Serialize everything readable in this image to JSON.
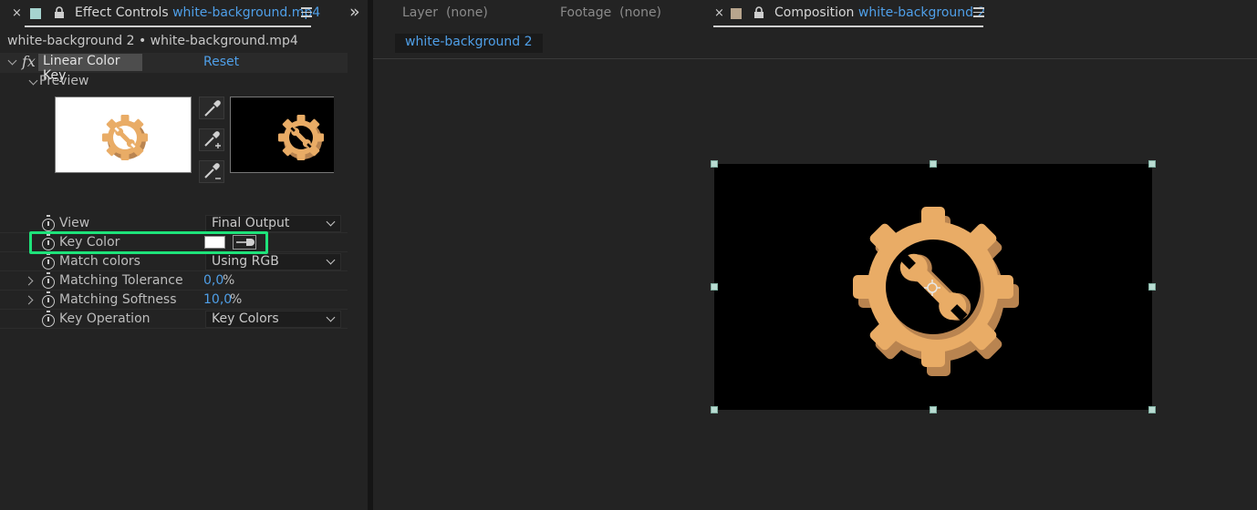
{
  "effect_controls_tab": {
    "label": "Effect Controls",
    "file": "white-background.mp4",
    "close_glyph": "×",
    "swatch_color": "#a6d4cf",
    "icons": [
      "close-icon",
      "lock-icon",
      "panel-menu-icon",
      "overflow-chevron-icon"
    ]
  },
  "overflow_glyph": "»",
  "breadcrumb": "white-background 2 • white-background.mp4",
  "effect": {
    "fx_label": "fx",
    "name": "Linear Color Key",
    "reset_label": "Reset",
    "preview_label": "Preview",
    "preview_icons": [
      "eyedropper-icon",
      "eyedropper-add-icon",
      "eyedropper-subtract-icon"
    ],
    "properties": {
      "view": {
        "label": "View",
        "value": "Final Output"
      },
      "key_color": {
        "label": "Key Color",
        "color": "#ffffff"
      },
      "match_colors": {
        "label": "Match colors",
        "value": "Using RGB"
      },
      "matching_tolerance": {
        "label": "Matching Tolerance",
        "value": "0,0",
        "unit": "%"
      },
      "matching_softness": {
        "label": "Matching Softness",
        "value": "10,0",
        "unit": "%"
      },
      "key_operation": {
        "label": "Key Operation",
        "value": "Key Colors"
      }
    }
  },
  "layer_tab": {
    "label": "Layer",
    "value": "(none)"
  },
  "footage_tab": {
    "label": "Footage",
    "value": "(none)"
  },
  "composition_tab": {
    "close_glyph": "×",
    "label": "Composition",
    "name": "white-background 2",
    "swatch_color": "#b8a58d"
  },
  "comp_subtab": "white-background 2",
  "colors": {
    "accent_blue": "#4f9fe8",
    "highlight_green": "#1ee27a",
    "gear_orange": "#e9ac66",
    "gear_shadow": "#b98450",
    "panel_bg": "#232323"
  }
}
